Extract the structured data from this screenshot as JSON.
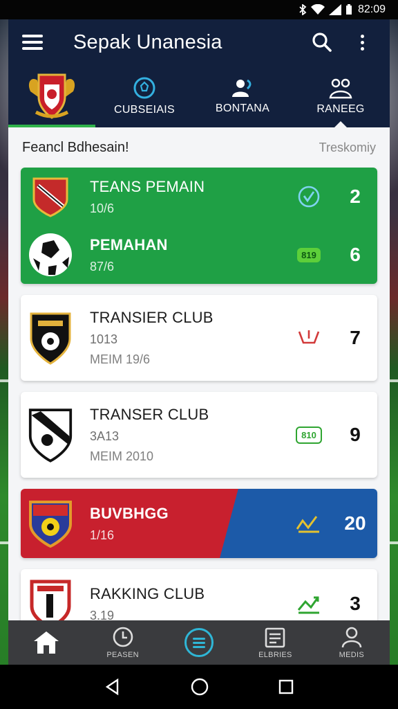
{
  "status_bar": {
    "time": "82:09"
  },
  "app_bar": {
    "title": "Sepak Unanesia"
  },
  "tabs": [
    {
      "label": "CUBSEIAIS",
      "icon": "soccer-ball-icon"
    },
    {
      "label": "BONTANA",
      "icon": "people-icon"
    },
    {
      "label": "RANEEG",
      "icon": "users-icon"
    }
  ],
  "section": {
    "title": "Feancl Bdhesain!",
    "link": "Treskomiy"
  },
  "entries": [
    {
      "name": "TEANS PEMAIN",
      "sub": "10/6",
      "badge_icon": "check-circle-icon",
      "rank": "2"
    },
    {
      "name": "PEMAHAN",
      "sub": "87/6",
      "badge": "819",
      "rank": "6"
    },
    {
      "name": "TRANSIER CLUB",
      "sub": "1013",
      "sub2": "MEIM 19/6",
      "badge_icon": "trend-down-icon",
      "rank": "7"
    },
    {
      "name": "TRANSER CLUB",
      "sub": "3A13",
      "sub2": "MEIM 2010",
      "badge": "810",
      "rank": "9"
    },
    {
      "name": "BUVBHGG",
      "sub": "1/16",
      "badge_icon": "trend-up-icon",
      "rank": "20"
    },
    {
      "name": "RAKKING CLUB",
      "sub": "3.19",
      "badge_icon": "trend-up-icon",
      "rank": "3"
    }
  ],
  "bottom_nav": [
    {
      "label": "",
      "icon": "home-icon"
    },
    {
      "label": "PEASEN",
      "icon": "clock-icon"
    },
    {
      "label": "",
      "icon": "menu-circle-icon"
    },
    {
      "label": "ELBRIES",
      "icon": "clipboard-icon"
    },
    {
      "label": "MEDIS",
      "icon": "person-icon"
    }
  ],
  "colors": {
    "app_bar": "#12203d",
    "accent_green": "#1fa045",
    "card_red": "#c8202e",
    "card_blue": "#1c5aa8",
    "nav_accent": "#2fb6d6"
  }
}
